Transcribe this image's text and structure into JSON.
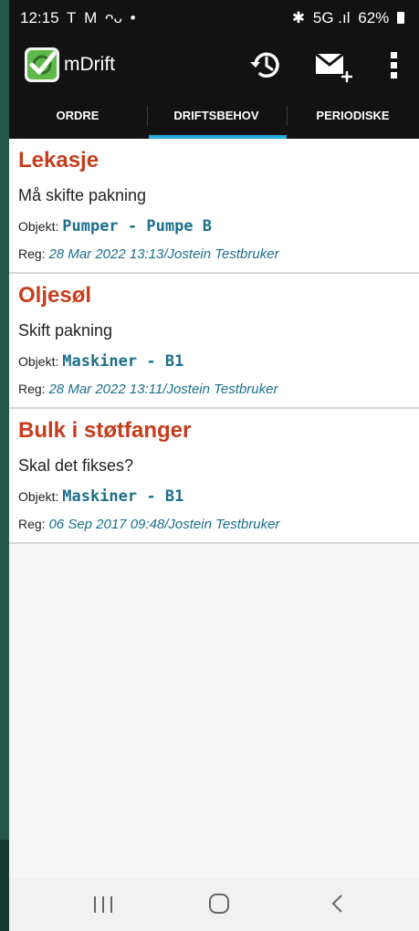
{
  "status_bar": {
    "time": "12:15",
    "left_icons": [
      "T",
      "M",
      "ᴖᴗ",
      "•"
    ],
    "bluetooth": "✱",
    "signal": "5G .ıl",
    "battery": "62%"
  },
  "app_bar": {
    "title": "mDrift",
    "logo_icon": "green-checkbox-logo",
    "actions": [
      "history-icon",
      "mail-add-icon",
      "more-vert-icon"
    ]
  },
  "tabs": [
    {
      "label": "ORDRE",
      "selected": false
    },
    {
      "label": "DRIFTSBEHOV",
      "selected": true
    },
    {
      "label": "PERIODISKE",
      "selected": false
    }
  ],
  "items": [
    {
      "title": "Lekasje",
      "description": "Må skifte pakning",
      "objekt_label": "Objekt:",
      "objekt": "Pumper - Pumpe B",
      "reg_label": "Reg:",
      "reg": "28 Mar 2022 13:13/Jostein Testbruker"
    },
    {
      "title": "Oljesøl",
      "description": "Skift pakning",
      "objekt_label": "Objekt:",
      "objekt": "Maskiner - B1",
      "reg_label": "Reg:",
      "reg": "28 Mar 2022 13:11/Jostein Testbruker"
    },
    {
      "title": "Bulk i støtfanger",
      "description": "Skal det fikses?",
      "objekt_label": "Objekt:",
      "objekt": "Maskiner - B1",
      "reg_label": "Reg:",
      "reg": "06 Sep 2017 09:48/Jostein Testbruker"
    }
  ],
  "colors": {
    "title_red": "#c63d1c",
    "value_blue": "#1c6f8c",
    "tab_indicator": "#29a9e0",
    "bar_dark": "#121212"
  },
  "nav_bar": [
    "recents-icon",
    "home-icon",
    "back-icon"
  ]
}
